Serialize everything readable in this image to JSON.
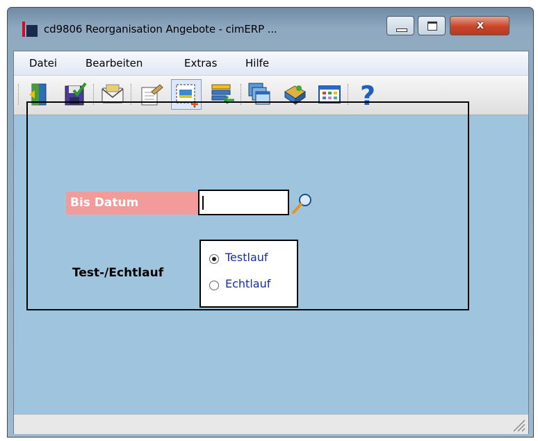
{
  "window": {
    "title": "cd9806 Reorganisation Angebote - cimERP ...",
    "close_label": "x"
  },
  "menu": {
    "items": [
      "Datei",
      "Bearbeiten",
      "Extras",
      "Hilfe"
    ]
  },
  "toolbar": {
    "help_glyph": "?",
    "icons": [
      "exit-door-icon",
      "save-icon",
      "mail-icon",
      "edit-document-icon",
      "new-record-icon",
      "list-transfer-icon",
      "windows-icon",
      "book-icon",
      "grid-table-icon",
      "help-icon"
    ]
  },
  "form": {
    "bis_datum_label": "Bis Datum",
    "bis_datum_value": "",
    "test_echtlauf_label": "Test-/Echtlauf",
    "options": [
      {
        "label": "Testlauf",
        "selected": true
      },
      {
        "label": "Echtlauf",
        "selected": false
      }
    ]
  },
  "colors": {
    "client_bg": "#9fc4de",
    "label_bg": "#f39b9b",
    "radio_text": "#1a2c9a"
  }
}
